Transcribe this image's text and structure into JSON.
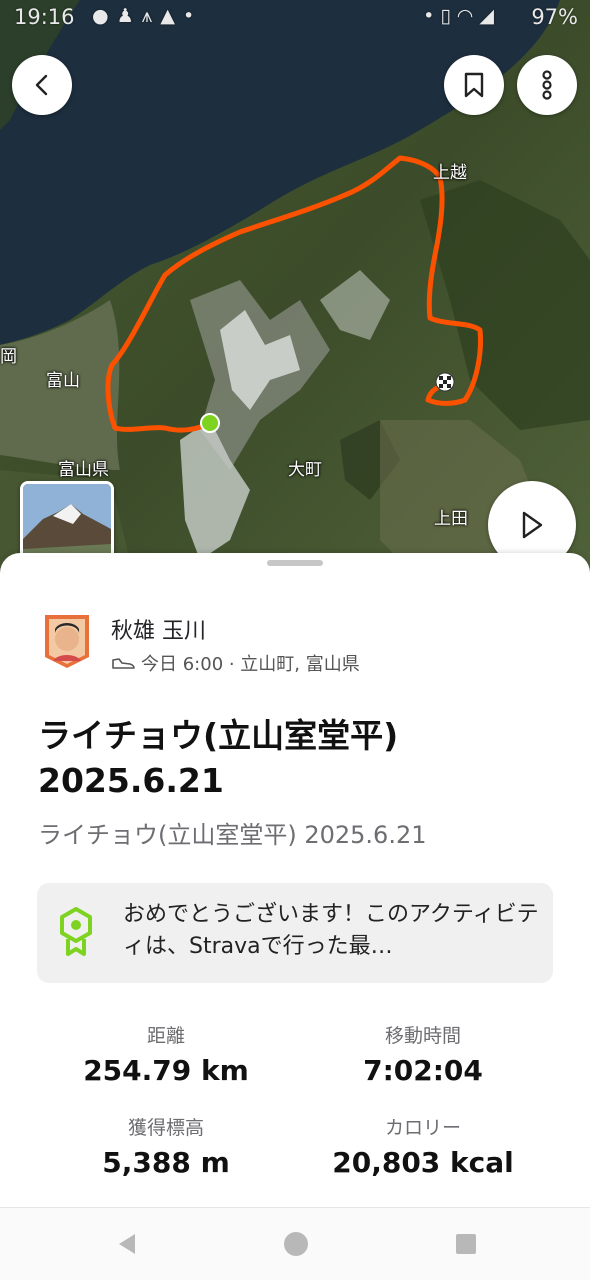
{
  "status_bar": {
    "time": "19:16",
    "battery": "97%"
  },
  "map": {
    "labels": {
      "joetsu": "上越",
      "toyama_city": "富山",
      "toyama_pref": "富山県",
      "omachi": "大町",
      "ueda": "上田",
      "oka": "岡"
    }
  },
  "athlete": {
    "name": "秋雄 玉川",
    "meta": "今日 6:00 · 立山町, 富山県"
  },
  "activity": {
    "title": "ライチョウ(立山室堂平) 2025.6.21",
    "subtitle": "ライチョウ(立山室堂平) 2025.6.21"
  },
  "achievement": {
    "text": "おめでとうございます！このアクティビティは、Stravaで行った最…"
  },
  "stats": [
    {
      "label": "距離",
      "value": "254.79 km"
    },
    {
      "label": "移動時間",
      "value": "7:02:04"
    },
    {
      "label": "獲得標高",
      "value": "5,388 m"
    },
    {
      "label": "カロリー",
      "value": "20,803 kcal"
    }
  ],
  "colors": {
    "route": "#fc5200",
    "start_marker": "#7ed321",
    "achievement_badge": "#7ed321",
    "sea": "#1d2e3e"
  },
  "icons": {
    "back": "chevron-left-icon",
    "bookmark": "bookmark-icon",
    "more": "more-vertical-icon",
    "play": "play-icon",
    "shoe": "shoe-icon",
    "badge": "achievement-badge-icon"
  }
}
